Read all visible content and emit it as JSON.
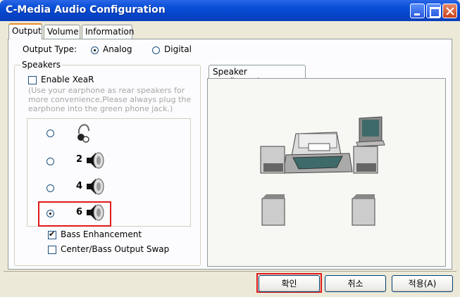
{
  "window": {
    "title": "C-Media Audio Configuration"
  },
  "tabs": [
    {
      "label": "Output"
    },
    {
      "label": "Volume"
    },
    {
      "label": "Information"
    }
  ],
  "output_type": {
    "label": "Output Type:",
    "options": [
      "Analog",
      "Digital"
    ],
    "selected": "Analog"
  },
  "speakers": {
    "group_label": "Speakers",
    "xear_label": "Enable XeaR",
    "xear_hint": "(Use your earphone as rear speakers for more convenience,Please always plug the earphone into the green phone jack.)",
    "options": [
      {
        "label": "",
        "icon": "headphones-icon"
      },
      {
        "label": "2",
        "icon": "speaker-icon"
      },
      {
        "label": "4",
        "icon": "speaker-icon"
      },
      {
        "label": "6",
        "icon": "speaker-icon"
      }
    ],
    "selected_index": 3,
    "bass_label": "Bass Enhancement",
    "bass_checked": true,
    "swap_label": "Center/Bass Output Swap",
    "swap_checked": false
  },
  "speaker_config": {
    "title": "Speaker Configuration"
  },
  "buttons": {
    "ok": "확인",
    "cancel": "취소",
    "apply": "적용(A)"
  },
  "colors": {
    "title_bar": "#0a4fd8",
    "highlight": "#e11a1a",
    "face": "#ece9d8"
  }
}
